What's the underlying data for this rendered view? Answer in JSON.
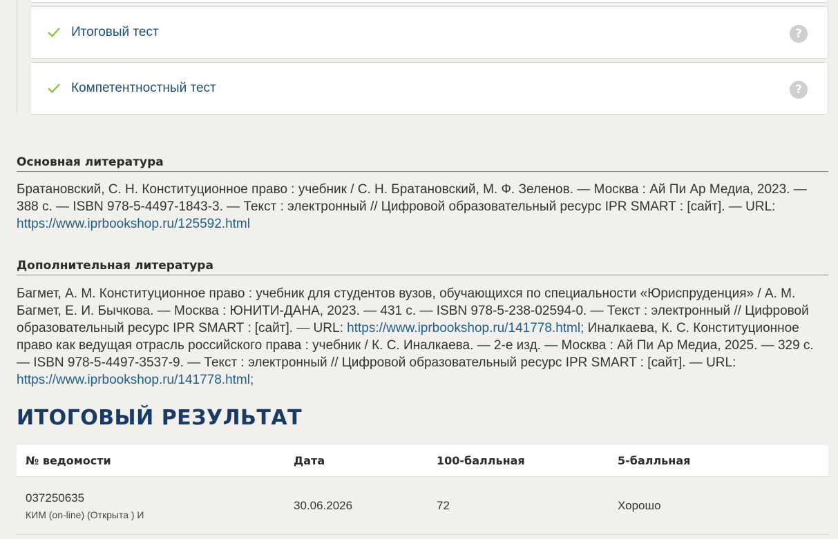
{
  "tests": [
    {
      "label": "Итоговый тест",
      "status_icon": "check-icon",
      "help": "?"
    },
    {
      "label": "Компетентностный тест",
      "status_icon": "check-icon",
      "help": "?"
    }
  ],
  "main_literature": {
    "title": "Основная литература",
    "text": "Братановский, С. Н. Конституционное право : учебник / С. Н. Братановский, М. Ф. Зеленов. — Москва : Ай Пи Ар Медиа, 2023. — 388 с. — ISBN 978-5-4497-1843-3. — Текст : электронный // Цифровой образовательный ресурс IPR SMART : [сайт]. — URL: ",
    "link": "https://www.iprbookshop.ru/125592.html"
  },
  "additional_literature": {
    "title": "Дополнительная литература",
    "text_1": "Багмет, А. М. Конституционное право : учебник для студентов вузов, обучающихся по специальности «Юриспруденция» / А. М. Багмет, Е. И. Бычкова. — Москва : ЮНИТИ-ДАНА, 2023. — 431 с. — ISBN 978-5-238-02594-0. — Текст : электронный // Цифровой образовательный ресурс IPR SMART : [сайт]. — URL: ",
    "link_1": "https://www.iprbookshop.ru/141778.html;",
    "text_2": " Иналкаева, К. С. Конституционное право как ведущая отрасль российского права : учебник / К. С. Иналкаева. — 2-е изд. — Москва : Ай Пи Ар Медиа, 2025. — 329 с. — ISBN 978-5-4497-3537-9. — Текст : электронный // Цифровой образовательный ресурс IPR SMART : [сайт]. — URL: ",
    "link_2": "https://www.iprbookshop.ru/141778.html;"
  },
  "result": {
    "heading": "ИТОГОВЫЙ РЕЗУЛЬТАТ",
    "columns": [
      "№ ведомости",
      "Дата",
      "100-балльная",
      "5-балльная"
    ],
    "rows": [
      {
        "number": "037250635",
        "note": "КИМ (on-line) (Открыта ) И",
        "date": "30.06.2026",
        "score100": "72",
        "score5": "Хорошо"
      }
    ]
  },
  "colors": {
    "accent": "#8cc63f",
    "link": "#1f5f8b",
    "heading": "#1a3a66"
  }
}
